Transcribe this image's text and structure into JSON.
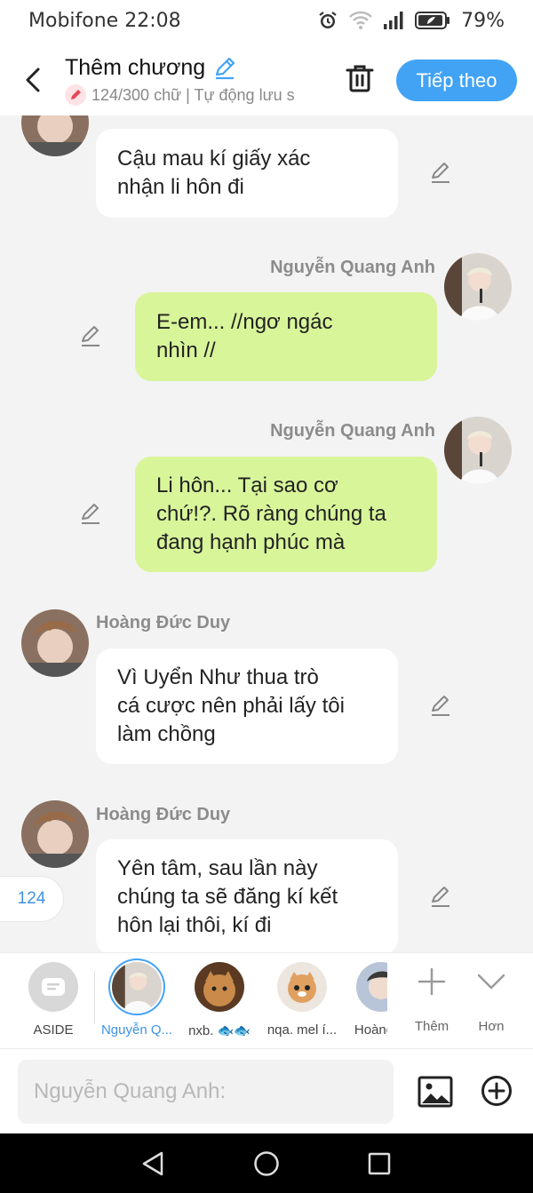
{
  "status_bar": {
    "carrier": "Mobifone",
    "time": "22:08",
    "battery": "79%"
  },
  "header": {
    "title": "Thêm chương",
    "subtitle": "124/300 chữ | Tự động lưu s",
    "next_label": "Tiếp theo"
  },
  "messages": [
    {
      "sender": "",
      "side": "left",
      "lines": [
        "Cậu mau kí giấy xác",
        "nhận li hôn đi"
      ]
    },
    {
      "sender": "Nguyễn Quang Anh",
      "side": "right",
      "lines": [
        "E-em... //ngơ ngác",
        "nhìn //"
      ]
    },
    {
      "sender": "Nguyễn Quang Anh",
      "side": "right",
      "lines": [
        "Li hôn... Tại sao cơ",
        "chứ!?. Rõ ràng chúng ta",
        "đang hạnh phúc mà"
      ]
    },
    {
      "sender": "Hoàng Đức Duy",
      "side": "left",
      "lines": [
        "Vì Uyển Như thua trò",
        "cá cược nên phải lấy tôi",
        "làm chồng"
      ]
    },
    {
      "sender": "Hoàng Đức Duy",
      "side": "left",
      "lines": [
        "Yên tâm, sau lần này",
        "chúng ta sẽ đăng kí kết",
        "hôn lại thôi, kí đi"
      ]
    }
  ],
  "word_counter": "124",
  "characters": [
    {
      "name": "ASIDE"
    },
    {
      "name": "Nguyễn Q..."
    },
    {
      "name": "nxb. 🐟🐟"
    },
    {
      "name": "nqa. mel í..."
    },
    {
      "name": "Hoàng"
    }
  ],
  "tools": {
    "add_label": "Thêm",
    "more_label": "Hơn"
  },
  "input": {
    "placeholder": "Nguyễn Quang Anh:"
  },
  "colors": {
    "accent": "#42a3f5",
    "right_bubble": "#d8f59a",
    "left_bubble": "#ffffff",
    "background": "#f3f3f3"
  }
}
